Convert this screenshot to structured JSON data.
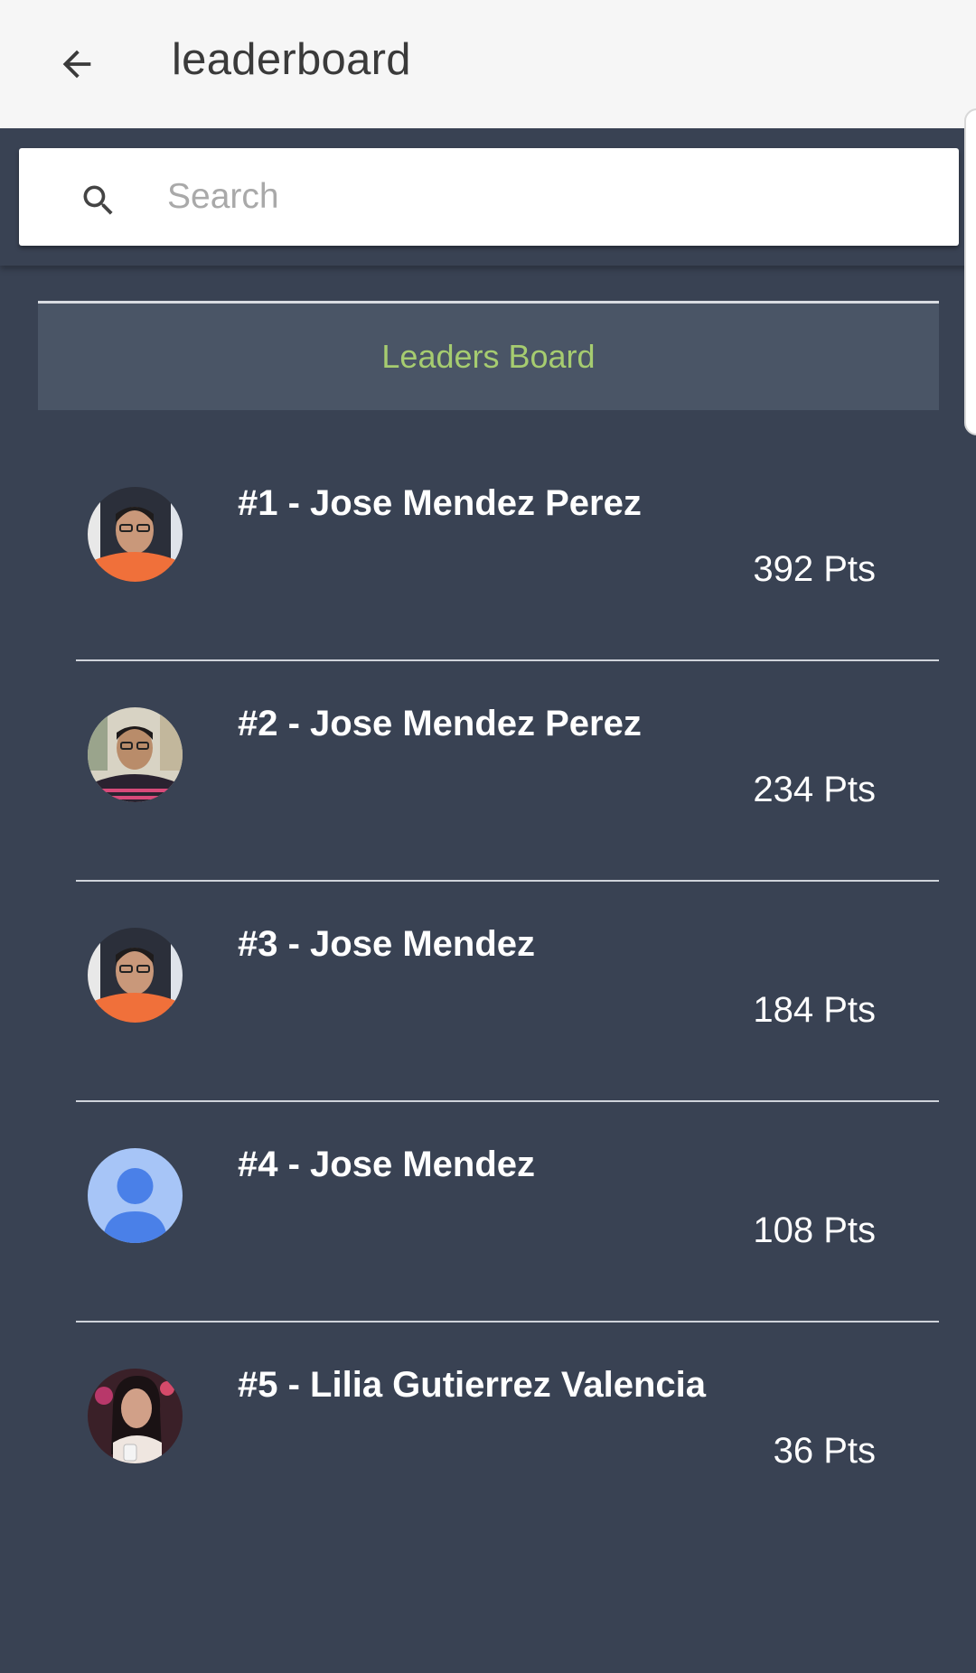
{
  "appbar": {
    "title": "leaderboard",
    "back_icon": "arrow-left-icon"
  },
  "search": {
    "placeholder": "Search",
    "value": "",
    "icon": "search-icon"
  },
  "leaderboard": {
    "header": "Leaders Board",
    "header_color": "#a6cc70",
    "entries": [
      {
        "rank_name": "#1 - Jose Mendez Perez",
        "points": "392 Pts",
        "avatar": "photo-man-orange-shirt"
      },
      {
        "rank_name": "#2 - Jose Mendez Perez",
        "points": "234 Pts",
        "avatar": "photo-man-striped-shirt"
      },
      {
        "rank_name": "#3 - Jose Mendez",
        "points": "184 Pts",
        "avatar": "photo-man-orange-shirt"
      },
      {
        "rank_name": "#4 - Jose Mendez",
        "points": "108 Pts",
        "avatar": "default-person-icon"
      },
      {
        "rank_name": "#5 - Lilia Gutierrez Valencia",
        "points": "36 Pts",
        "avatar": "photo-woman"
      }
    ]
  },
  "colors": {
    "background": "#394253",
    "appbar": "#f6f6f6",
    "accent": "#a6cc70"
  }
}
